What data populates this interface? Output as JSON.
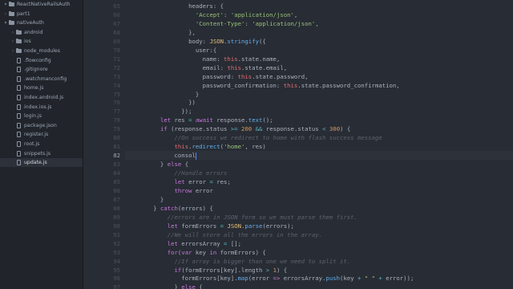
{
  "sidebar": {
    "items": [
      {
        "label": "ReactNativeRailsAuth",
        "type": "folder",
        "depth": 0,
        "expanded": true
      },
      {
        "label": "part1",
        "type": "folder",
        "depth": 0,
        "expanded": false
      },
      {
        "label": "nativeAuth",
        "type": "folder",
        "depth": 0,
        "expanded": true
      },
      {
        "label": "android",
        "type": "folder",
        "depth": 1,
        "expanded": false
      },
      {
        "label": "ios",
        "type": "folder",
        "depth": 1,
        "expanded": false
      },
      {
        "label": "node_modules",
        "type": "folder",
        "depth": 1,
        "expanded": false
      },
      {
        "label": ".flowconfig",
        "type": "file",
        "depth": 1
      },
      {
        "label": ".gitignore",
        "type": "file",
        "depth": 1
      },
      {
        "label": ".watchmanconfig",
        "type": "file",
        "depth": 1
      },
      {
        "label": "home.js",
        "type": "file",
        "depth": 1
      },
      {
        "label": "index.android.js",
        "type": "file",
        "depth": 1
      },
      {
        "label": "index.ios.js",
        "type": "file",
        "depth": 1
      },
      {
        "label": "login.js",
        "type": "file",
        "depth": 1
      },
      {
        "label": "package.json",
        "type": "file",
        "depth": 1
      },
      {
        "label": "register.js",
        "type": "file",
        "depth": 1
      },
      {
        "label": "root.js",
        "type": "file",
        "depth": 1
      },
      {
        "label": "snippets.js",
        "type": "file",
        "depth": 1
      },
      {
        "label": "update.js",
        "type": "file",
        "depth": 1,
        "selected": true
      }
    ]
  },
  "editor": {
    "current_line": 82,
    "lines": [
      {
        "n": 65,
        "tokens": [
          [
            "                  ",
            "t"
          ],
          [
            "headers",
            "t"
          ],
          [
            ": {",
            "t"
          ]
        ]
      },
      {
        "n": 66,
        "tokens": [
          [
            "                    ",
            "t"
          ],
          [
            "'Accept'",
            "s"
          ],
          [
            ": ",
            "t"
          ],
          [
            "'application/json'",
            "s"
          ],
          [
            ",",
            "t"
          ]
        ]
      },
      {
        "n": 67,
        "tokens": [
          [
            "                    ",
            "t"
          ],
          [
            "'Content-Type'",
            "s"
          ],
          [
            ": ",
            "t"
          ],
          [
            "'application/json'",
            "s"
          ],
          [
            ",",
            "t"
          ]
        ]
      },
      {
        "n": 68,
        "tokens": [
          [
            "                  },",
            "t"
          ]
        ]
      },
      {
        "n": 69,
        "tokens": [
          [
            "                  ",
            "t"
          ],
          [
            "body",
            "t"
          ],
          [
            ": ",
            "t"
          ],
          [
            "JSON",
            "y"
          ],
          [
            ".",
            "t"
          ],
          [
            "stringify",
            "f"
          ],
          [
            "({",
            "t"
          ]
        ]
      },
      {
        "n": 70,
        "tokens": [
          [
            "                    ",
            "t"
          ],
          [
            "user",
            "t"
          ],
          [
            ":{",
            "t"
          ]
        ]
      },
      {
        "n": 71,
        "tokens": [
          [
            "                      ",
            "t"
          ],
          [
            "name",
            "t"
          ],
          [
            ": ",
            "t"
          ],
          [
            "this",
            "p"
          ],
          [
            ".state.name,",
            "t"
          ]
        ]
      },
      {
        "n": 72,
        "tokens": [
          [
            "                      ",
            "t"
          ],
          [
            "email",
            "t"
          ],
          [
            ": ",
            "t"
          ],
          [
            "this",
            "p"
          ],
          [
            ".state.email,",
            "t"
          ]
        ]
      },
      {
        "n": 73,
        "tokens": [
          [
            "                      ",
            "t"
          ],
          [
            "password",
            "t"
          ],
          [
            ": ",
            "t"
          ],
          [
            "this",
            "p"
          ],
          [
            ".state.password,",
            "t"
          ]
        ]
      },
      {
        "n": 74,
        "tokens": [
          [
            "                      ",
            "t"
          ],
          [
            "password_confirmation",
            "t"
          ],
          [
            ": ",
            "t"
          ],
          [
            "this",
            "p"
          ],
          [
            ".state.password_confirmation,",
            "t"
          ]
        ]
      },
      {
        "n": 75,
        "tokens": [
          [
            "                    }",
            "t"
          ]
        ]
      },
      {
        "n": 76,
        "tokens": [
          [
            "                  })",
            "t"
          ]
        ]
      },
      {
        "n": 77,
        "tokens": [
          [
            "                });",
            "t"
          ]
        ]
      },
      {
        "n": 78,
        "tokens": [
          [
            "          ",
            "t"
          ],
          [
            "let",
            "k"
          ],
          [
            " res ",
            "t"
          ],
          [
            "=",
            "o"
          ],
          [
            " ",
            "t"
          ],
          [
            "await",
            "k"
          ],
          [
            " response.",
            "t"
          ],
          [
            "text",
            "f"
          ],
          [
            "();",
            "t"
          ]
        ]
      },
      {
        "n": 79,
        "tokens": [
          [
            "          ",
            "t"
          ],
          [
            "if",
            "k"
          ],
          [
            " (response.status ",
            "t"
          ],
          [
            ">=",
            "o"
          ],
          [
            " ",
            "t"
          ],
          [
            "200",
            "n"
          ],
          [
            " ",
            "t"
          ],
          [
            "&&",
            "o"
          ],
          [
            " response.status ",
            "t"
          ],
          [
            "<",
            "o"
          ],
          [
            " ",
            "t"
          ],
          [
            "300",
            "n"
          ],
          [
            ") {",
            "t"
          ]
        ]
      },
      {
        "n": 80,
        "tokens": [
          [
            "              ",
            "t"
          ],
          [
            "//On success we redirect to home with flash success message",
            "c"
          ]
        ]
      },
      {
        "n": 81,
        "tokens": [
          [
            "              ",
            "t"
          ],
          [
            "this",
            "p"
          ],
          [
            ".",
            "t"
          ],
          [
            "redirect",
            "f"
          ],
          [
            "(",
            "t"
          ],
          [
            "'home'",
            "s"
          ],
          [
            ", res)",
            "t"
          ]
        ]
      },
      {
        "n": 82,
        "tokens": [
          [
            "              ",
            "t"
          ],
          [
            "consol",
            "t"
          ]
        ],
        "cursor": true
      },
      {
        "n": 83,
        "tokens": [
          [
            "          } ",
            "t"
          ],
          [
            "else",
            "k"
          ],
          [
            " {",
            "t"
          ]
        ]
      },
      {
        "n": 84,
        "tokens": [
          [
            "              ",
            "t"
          ],
          [
            "//Handle errors",
            "c"
          ]
        ]
      },
      {
        "n": 85,
        "tokens": [
          [
            "              ",
            "t"
          ],
          [
            "let",
            "k"
          ],
          [
            " error ",
            "t"
          ],
          [
            "=",
            "o"
          ],
          [
            " res;",
            "t"
          ]
        ]
      },
      {
        "n": 86,
        "tokens": [
          [
            "              ",
            "t"
          ],
          [
            "throw",
            "k"
          ],
          [
            " error",
            "t"
          ]
        ]
      },
      {
        "n": 87,
        "tokens": [
          [
            "          }",
            "t"
          ]
        ]
      },
      {
        "n": 88,
        "tokens": [
          [
            "        } ",
            "t"
          ],
          [
            "catch",
            "k"
          ],
          [
            "(errors) {",
            "t"
          ]
        ]
      },
      {
        "n": 89,
        "tokens": [
          [
            "            ",
            "t"
          ],
          [
            "//errors are in JSON form so we must parse them first.",
            "c"
          ]
        ]
      },
      {
        "n": 90,
        "tokens": [
          [
            "            ",
            "t"
          ],
          [
            "let",
            "k"
          ],
          [
            " formErrors ",
            "t"
          ],
          [
            "=",
            "o"
          ],
          [
            " ",
            "t"
          ],
          [
            "JSON",
            "y"
          ],
          [
            ".",
            "t"
          ],
          [
            "parse",
            "f"
          ],
          [
            "(errors);",
            "t"
          ]
        ]
      },
      {
        "n": 91,
        "tokens": [
          [
            "            ",
            "t"
          ],
          [
            "//We will store all the errors in the array.",
            "c"
          ]
        ]
      },
      {
        "n": 92,
        "tokens": [
          [
            "            ",
            "t"
          ],
          [
            "let",
            "k"
          ],
          [
            " errorsArray ",
            "t"
          ],
          [
            "=",
            "o"
          ],
          [
            " [];",
            "t"
          ]
        ]
      },
      {
        "n": 93,
        "tokens": [
          [
            "            ",
            "t"
          ],
          [
            "for",
            "k"
          ],
          [
            "(",
            "t"
          ],
          [
            "var",
            "k"
          ],
          [
            " key ",
            "t"
          ],
          [
            "in",
            "k"
          ],
          [
            " formErrors) {",
            "t"
          ]
        ]
      },
      {
        "n": 94,
        "tokens": [
          [
            "              ",
            "t"
          ],
          [
            "//If array is bigger than one we need to split it.",
            "c"
          ]
        ]
      },
      {
        "n": 95,
        "tokens": [
          [
            "              ",
            "t"
          ],
          [
            "if",
            "k"
          ],
          [
            "(formErrors[key].length ",
            "t"
          ],
          [
            ">",
            "o"
          ],
          [
            " ",
            "t"
          ],
          [
            "1",
            "n"
          ],
          [
            ") {",
            "t"
          ]
        ]
      },
      {
        "n": 96,
        "tokens": [
          [
            "                formErrors[key].",
            "t"
          ],
          [
            "map",
            "f"
          ],
          [
            "(error ",
            "t"
          ],
          [
            "=>",
            "k"
          ],
          [
            " errorsArray.",
            "t"
          ],
          [
            "push",
            "f"
          ],
          [
            "(key ",
            "t"
          ],
          [
            "+",
            "o"
          ],
          [
            " ",
            "t"
          ],
          [
            "\" \"",
            "s"
          ],
          [
            " ",
            "t"
          ],
          [
            "+",
            "o"
          ],
          [
            " error));",
            "t"
          ]
        ]
      },
      {
        "n": 97,
        "tokens": [
          [
            "              } ",
            "t"
          ],
          [
            "else",
            "k"
          ],
          [
            " {",
            "t"
          ]
        ]
      },
      {
        "n": 98,
        "tokens": [
          [
            "                errorsArray.",
            "t"
          ],
          [
            "push",
            "f"
          ],
          [
            "(key ",
            "t"
          ],
          [
            "+",
            "o"
          ],
          [
            " ",
            "t"
          ],
          [
            "\" \"",
            "s"
          ],
          [
            " ",
            "t"
          ],
          [
            "+",
            "o"
          ],
          [
            " formErrors[key]);",
            "t"
          ]
        ]
      }
    ]
  }
}
